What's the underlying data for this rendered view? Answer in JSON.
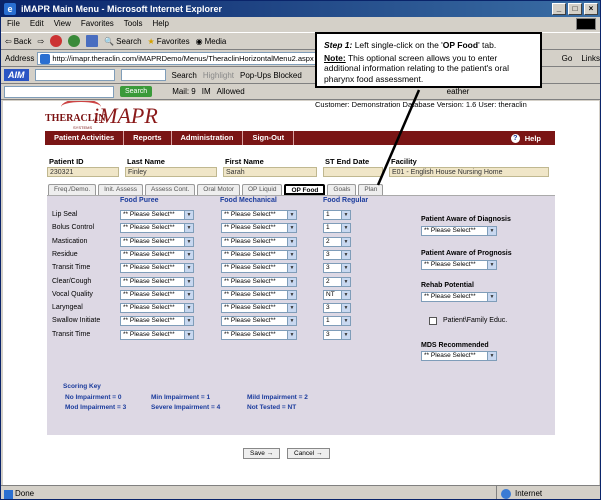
{
  "window": {
    "title": "iMAPR Main Menu - Microsoft Internet Explorer"
  },
  "menu": [
    "File",
    "Edit",
    "View",
    "Favorites",
    "Tools",
    "Help"
  ],
  "toolbar": {
    "back": "Back",
    "search": "Search",
    "favorites": "Favorites",
    "media": "Media"
  },
  "address": {
    "label": "Address",
    "url": "http://imapr.theraclin.com/iMAPRDemo/Menus/TheraclinHorizontalMenu2.aspx",
    "go": "Go",
    "links": "Links"
  },
  "aim": {
    "logo": "AIM",
    "search": "Search",
    "highlight": "Highlight",
    "popups": "Pop-Ups Blocked"
  },
  "bar3": {
    "search": "Search",
    "mail": "Mail: 9",
    "im": "IM",
    "allowed": "Allowed",
    "weather": "eather"
  },
  "callout": {
    "step": "Step 1:",
    "text1": " Left single-click on the '",
    "tabname": "OP Food",
    "text2": "' tab.",
    "note": "Note:",
    "notetext": " This optional screen allows you to enter additional information relating to the patient's oral pharynx food assessment."
  },
  "logo": {
    "brand": "THERACLIN",
    "systems": "SYSTEMS",
    "product": "iMAPR"
  },
  "customer": "Customer: Demonstration Database  Version: 1.6  User: theraclin",
  "nav": {
    "items": [
      "Patient Activities",
      "Reports",
      "Administration",
      "Sign-Out"
    ],
    "help": "Help"
  },
  "patient": {
    "id_label": "Patient ID",
    "id": "230321",
    "last_label": "Last Name",
    "last": "Finley",
    "first_label": "First Name",
    "first": "Sarah",
    "st_label": "ST End Date",
    "st": "",
    "facility_label": "Facility",
    "facility": "E01 - English House Nursing Home"
  },
  "tabs": [
    "Freq./Demo.",
    "Init. Assess",
    "Assess Cont.",
    "Oral Motor",
    "OP Liquid",
    "OP Food",
    "Goals",
    "Plan"
  ],
  "columns": [
    "Food Puree",
    "Food Mechanical",
    "Food Regular"
  ],
  "rows": [
    "Lip Seal",
    "Bolus Control",
    "Mastication",
    "Residue",
    "Transit Time",
    "Clear/Cough",
    "Vocal Quality",
    "Laryngeal",
    "Swallow Initiate",
    "Transit Time"
  ],
  "select_placeholder": "** Please Select**",
  "regular_values": [
    "1",
    "1",
    "2",
    "3",
    "3",
    "2",
    "NT",
    "3",
    "1",
    "3"
  ],
  "right": {
    "diag_label": "Patient Aware of Diagnosis",
    "prog_label": "Patient Aware of Prognosis",
    "rehab_label": "Rehab Potential",
    "educ_label": "Patient\\Family Educ.",
    "mds_label": "MDS Recommended"
  },
  "scoring": {
    "title": "Scoring Key",
    "l1a": "No Impairment = 0",
    "l1b": "Min Impairment = 1",
    "l1c": "Mild Impairment = 2",
    "l2a": "Mod Impairment = 3",
    "l2b": "Severe Impairment = 4",
    "l2c": "Not Tested = NT"
  },
  "buttons": {
    "save": "Save",
    "cancel": "Cancel"
  },
  "status": {
    "left": "Done",
    "right": "Internet"
  }
}
